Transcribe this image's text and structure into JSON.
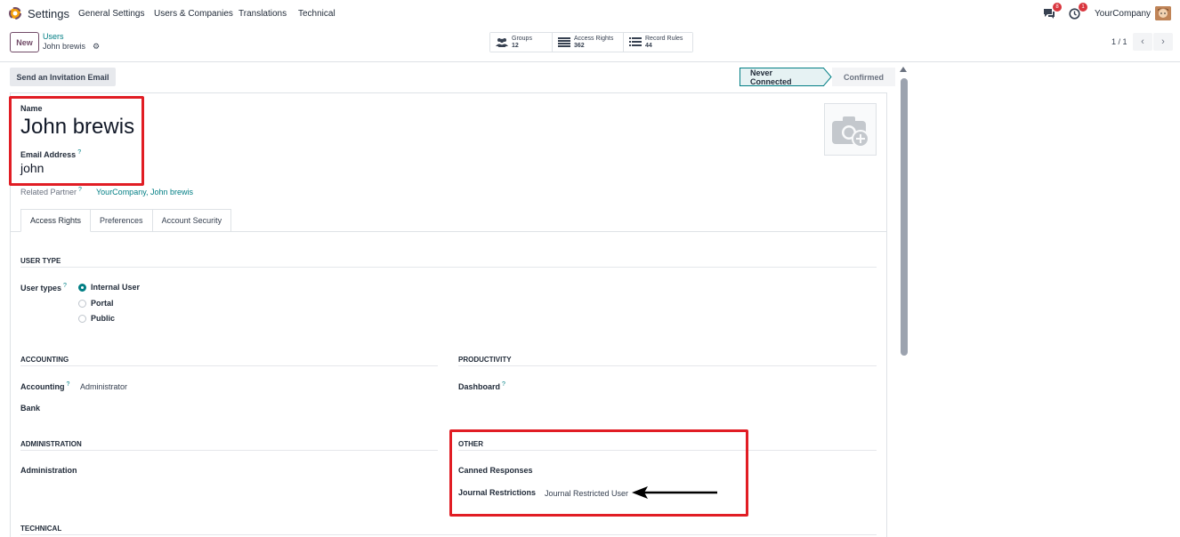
{
  "navbar": {
    "app_title": "Settings",
    "menus": [
      "General Settings",
      "Users & Companies",
      "Translations",
      "Technical"
    ],
    "messages_badge": "8",
    "activities_badge": "1",
    "company": "YourCompany"
  },
  "control_panel": {
    "new_label": "New",
    "breadcrumb_parent": "Users",
    "breadcrumb_current": "John brewis",
    "smart_buttons": [
      {
        "label": "Groups",
        "value": "12",
        "icon": "users-icon"
      },
      {
        "label": "Access Rights",
        "value": "362",
        "icon": "list-icon"
      },
      {
        "label": "Record Rules",
        "value": "44",
        "icon": "list-icon"
      }
    ],
    "pager": "1 / 1"
  },
  "form": {
    "invite_button": "Send an Invitation Email",
    "stages": [
      "Never Connected",
      "Confirmed"
    ],
    "active_stage": "Never Connected",
    "name_label": "Name",
    "name_value": "John brewis",
    "email_label": "Email Address",
    "email_value": "john",
    "related_partner_label": "Related Partner",
    "related_partner_value": "YourCompany, John brewis",
    "tabs": [
      "Access Rights",
      "Preferences",
      "Account Security"
    ],
    "active_tab": "Access Rights",
    "help_mark": "?"
  },
  "access_rights": {
    "user_type_title": "USER TYPE",
    "user_types_label": "User types",
    "user_type_options": [
      "Internal User",
      "Portal",
      "Public"
    ],
    "selected_user_type": "Internal User",
    "accounting_title": "ACCOUNTING",
    "accounting_label": "Accounting",
    "accounting_value": "Administrator",
    "bank_label": "Bank",
    "productivity_title": "PRODUCTIVITY",
    "dashboard_label": "Dashboard",
    "administration_title": "ADMINISTRATION",
    "administration_label": "Administration",
    "other_title": "OTHER",
    "canned_label": "Canned Responses",
    "journal_label": "Journal Restrictions",
    "journal_value": "Journal Restricted User",
    "technical_title": "TECHNICAL"
  },
  "colors": {
    "accent": "#017e84",
    "brand": "#714b67",
    "annotation": "#e11d24"
  }
}
